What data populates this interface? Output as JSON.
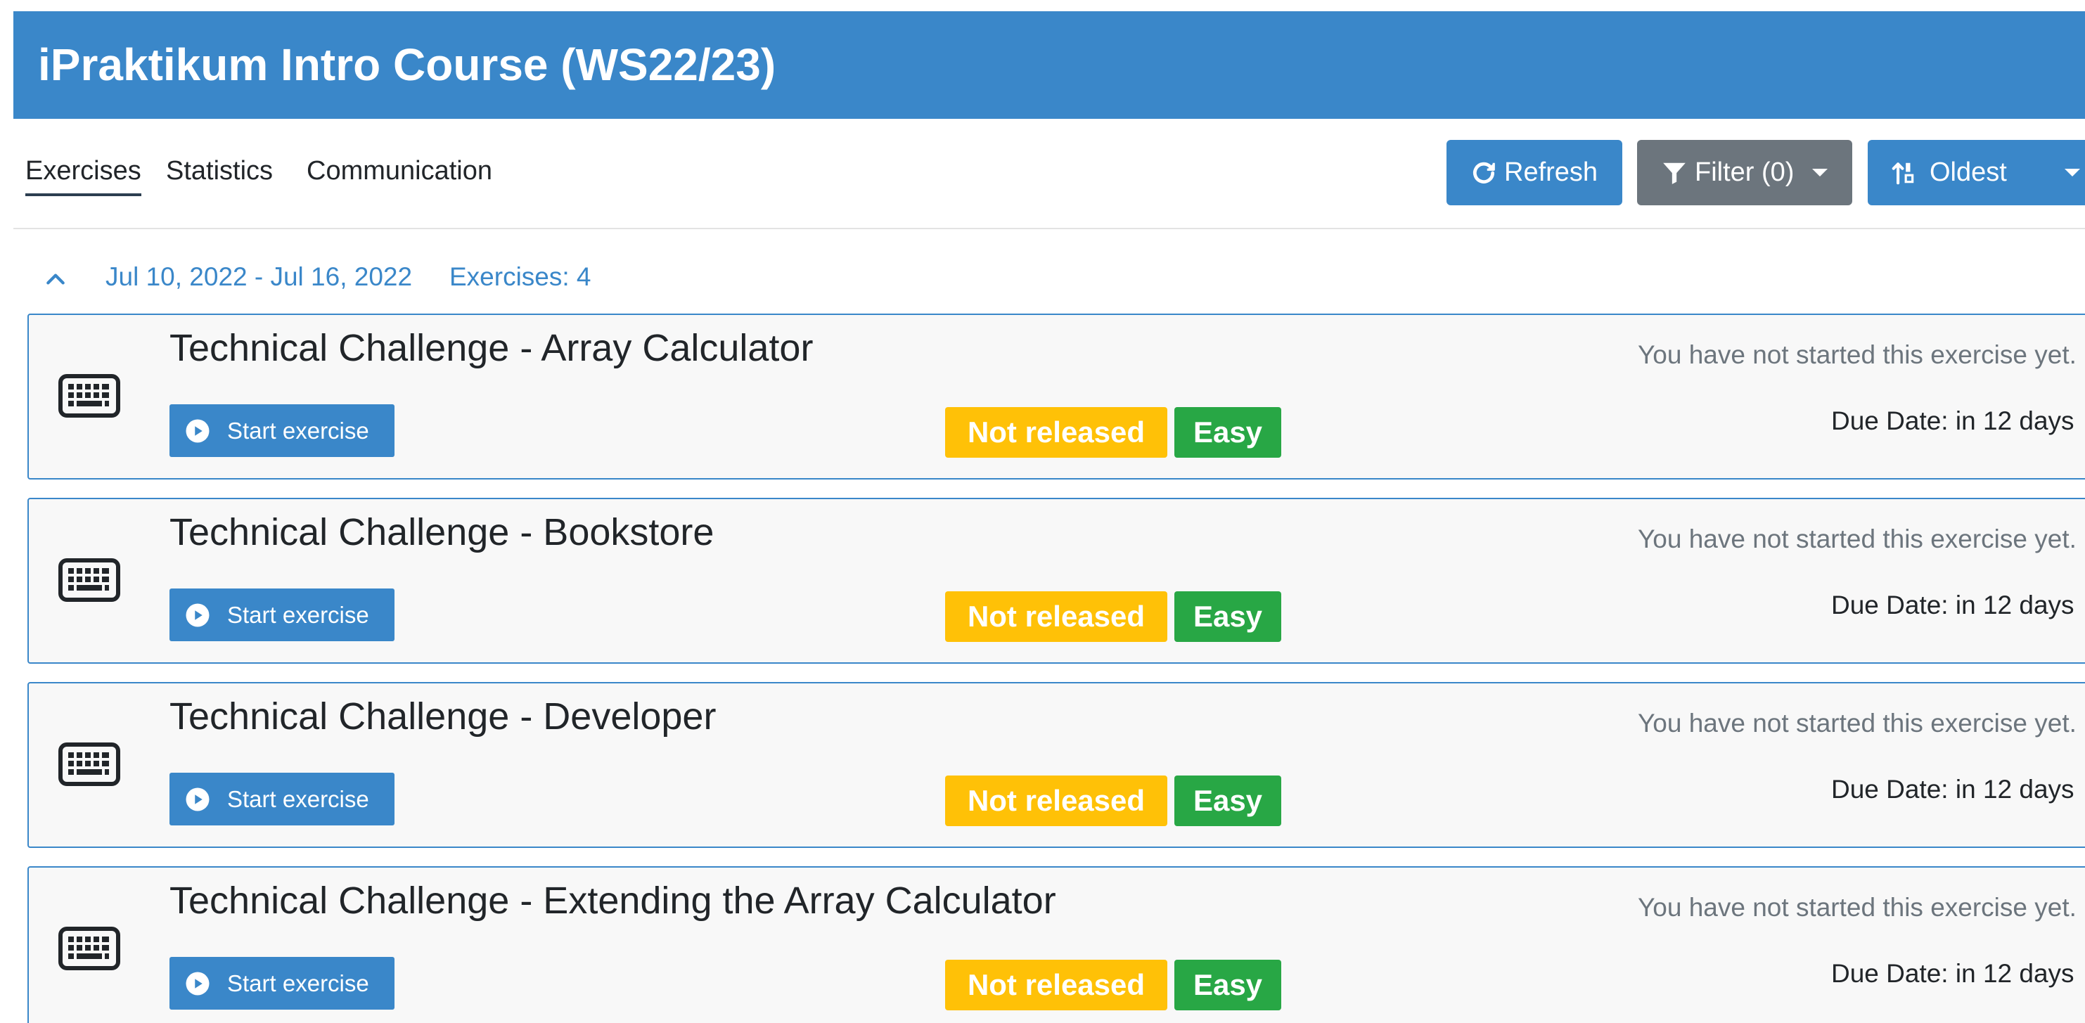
{
  "course": {
    "title": "iPraktikum Intro Course (WS22/23)"
  },
  "tabs": [
    {
      "label": "Exercises",
      "active": true
    },
    {
      "label": "Statistics",
      "active": false
    },
    {
      "label": "Communication",
      "active": false
    }
  ],
  "toolbar": {
    "refresh_label": "Refresh",
    "filter_label": "Filter (0)",
    "sort_label": "Oldest"
  },
  "group": {
    "date_range": "Jul 10, 2022 - Jul 16, 2022",
    "count_label": "Exercises: 4"
  },
  "exercises": [
    {
      "title": "Technical Challenge - Array Calculator",
      "start_label": "Start exercise",
      "status_badge": "Not released",
      "difficulty": "Easy",
      "progress_text": "You have not started this exercise yet.",
      "due_text": "Due Date: in 12 days"
    },
    {
      "title": "Technical Challenge - Bookstore",
      "start_label": "Start exercise",
      "status_badge": "Not released",
      "difficulty": "Easy",
      "progress_text": "You have not started this exercise yet.",
      "due_text": "Due Date: in 12 days"
    },
    {
      "title": "Technical Challenge - Developer",
      "start_label": "Start exercise",
      "status_badge": "Not released",
      "difficulty": "Easy",
      "progress_text": "You have not started this exercise yet.",
      "due_text": "Due Date: in 12 days"
    },
    {
      "title": "Technical Challenge - Extending the Array Calculator",
      "start_label": "Start exercise",
      "status_badge": "Not released",
      "difficulty": "Easy",
      "progress_text": "You have not started this exercise yet.",
      "due_text": "Due Date: in 12 days"
    }
  ],
  "colors": {
    "primary": "#3a87c9",
    "secondary": "#6c757d",
    "warning": "#ffc107",
    "success": "#28a745"
  },
  "icons": {
    "refresh": "refresh-icon",
    "filter": "filter-icon",
    "sort": "sort-icon",
    "collapse": "chevron-up-icon",
    "exercise_type": "keyboard-icon",
    "start": "play-circle-icon"
  }
}
